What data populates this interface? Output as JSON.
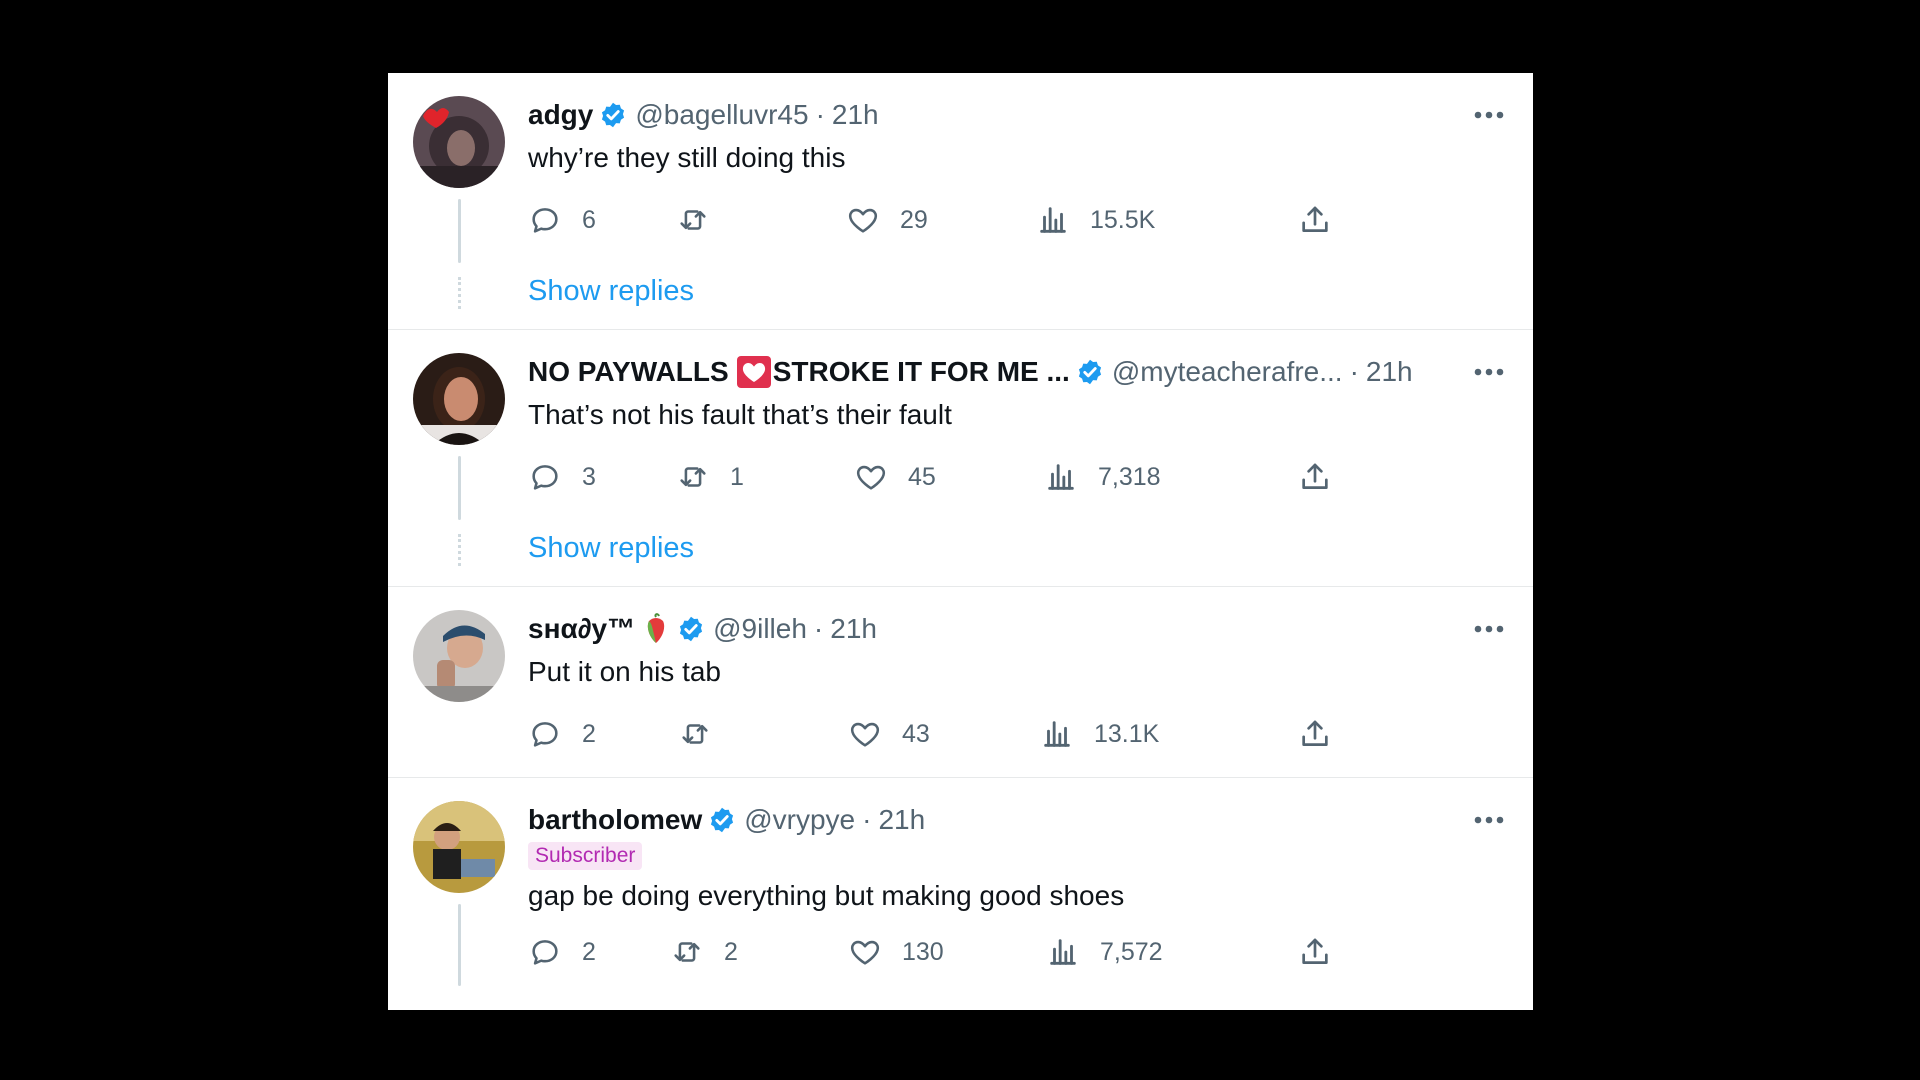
{
  "tweets": [
    {
      "name": "adgy",
      "handle": "@bagelluvr45",
      "separator": "·",
      "time": "21h",
      "text": "why’re they still doing this",
      "replies": "6",
      "retweets": "",
      "likes": "29",
      "views": "15.5K",
      "show_replies": "Show replies"
    },
    {
      "name_part1": "NO PAYWALLS",
      "name_emoji": "heart-emoji",
      "name_part2": "STROKE IT FOR ME ...",
      "handle": "@myteacherafre...",
      "separator": "·",
      "time": "21h",
      "text": "That’s not his fault that’s their fault",
      "replies": "3",
      "retweets": "1",
      "likes": "45",
      "views": "7,318",
      "show_replies": "Show replies"
    },
    {
      "name": "ѕнα∂у™",
      "name_emoji": "pepper-emoji",
      "handle": "@9illeh",
      "separator": "·",
      "time": "21h",
      "text": "Put it on his tab",
      "replies": "2",
      "retweets": "",
      "likes": "43",
      "views": "13.1K"
    },
    {
      "name": "bartholomew",
      "handle": "@vrypye",
      "separator": "·",
      "time": "21h",
      "badge": "Subscriber",
      "text": "gap be doing everything but making good shoes",
      "replies": "2",
      "retweets": "2",
      "likes": "130",
      "views": "7,572"
    }
  ],
  "icons": {
    "reply": "reply-icon",
    "retweet": "retweet-icon",
    "like": "heart-icon",
    "views": "views-icon",
    "share": "share-icon",
    "more": "more-options-icon",
    "verified": "verified-badge-icon"
  },
  "colors": {
    "accent": "#1d9bf0",
    "secondary_text": "#536471",
    "subscriber_badge_bg": "#f8e5f5",
    "subscriber_badge_text": "#b22ab2",
    "background": "#000000",
    "panel": "#ffffff"
  }
}
